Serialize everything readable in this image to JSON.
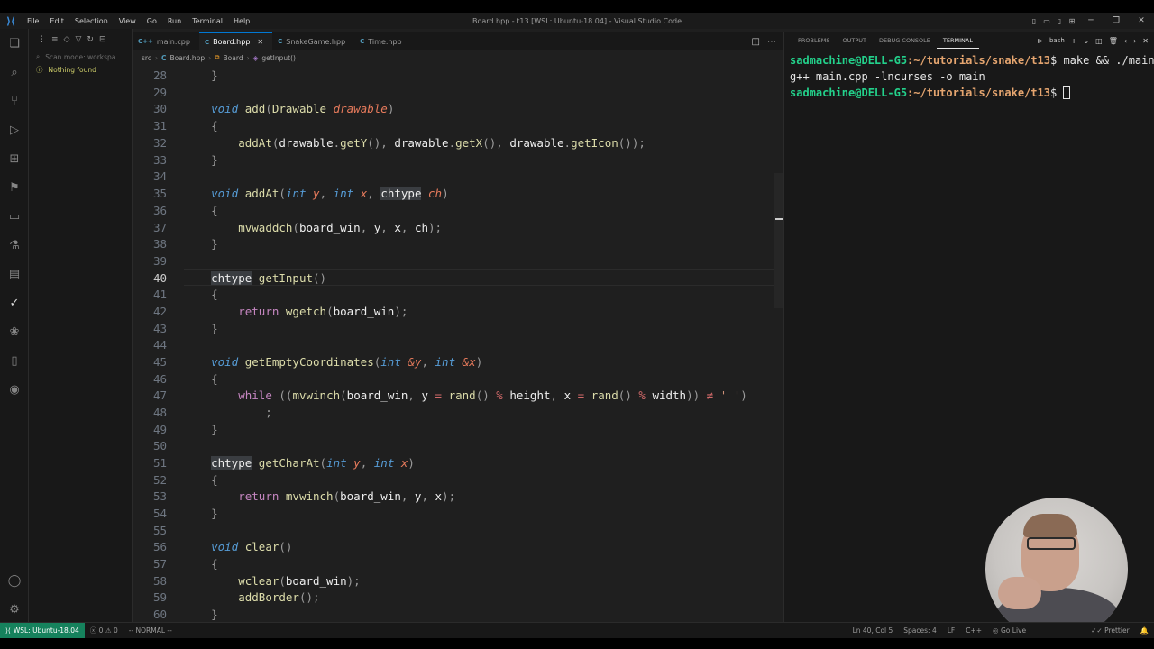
{
  "window": {
    "title": "Board.hpp - t13 [WSL: Ubuntu-18.04] - Visual Studio Code",
    "menu": [
      "File",
      "Edit",
      "Selection",
      "View",
      "Go",
      "Run",
      "Terminal",
      "Help"
    ]
  },
  "sidebar": {
    "scan_mode": "Scan mode: workspa...",
    "result": "Nothing found"
  },
  "tabs": [
    {
      "label": "main.cpp",
      "icon": "C++"
    },
    {
      "label": "Board.hpp",
      "icon": "C"
    },
    {
      "label": "SnakeGame.hpp",
      "icon": "C"
    },
    {
      "label": "Time.hpp",
      "icon": "C"
    }
  ],
  "breadcrumb": [
    "src",
    "Board.hpp",
    "Board",
    "getInput()"
  ],
  "editor": {
    "active_line": 40,
    "line_numbers": [
      "28",
      "29",
      "30",
      "31",
      "32",
      "33",
      "34",
      "35",
      "36",
      "37",
      "38",
      "39",
      "40",
      "41",
      "42",
      "43",
      "44",
      "45",
      "46",
      "47",
      "48",
      "49",
      "50",
      "51",
      "52",
      "53",
      "54",
      "55",
      "56",
      "57",
      "58",
      "59",
      "60"
    ]
  },
  "panel": {
    "tabs": [
      "PROBLEMS",
      "OUTPUT",
      "DEBUG CONSOLE",
      "TERMINAL"
    ],
    "shell": "bash",
    "terminal": {
      "user": "sadmachine@DELL-G5",
      "path": ":~/tutorials/snake/t13",
      "dollar": "$",
      "cmd1": " make && ./main",
      "output1": "g++ main.cpp -lncurses -o main"
    }
  },
  "statusbar": {
    "remote": "WSL: Ubuntu-18.04",
    "problems": "0",
    "warnings": "0",
    "vim_mode": "-- NORMAL --",
    "position": "Ln 40, Col 5",
    "spaces": "Spaces: 4",
    "eol": "LF",
    "language": "C++",
    "golive": "Go Live",
    "prettier": "Prettier"
  },
  "colors": {
    "accent": "#0078d4",
    "remote": "#16825d",
    "terminal_user": "#23d18b",
    "terminal_path": "#e5a56f"
  }
}
